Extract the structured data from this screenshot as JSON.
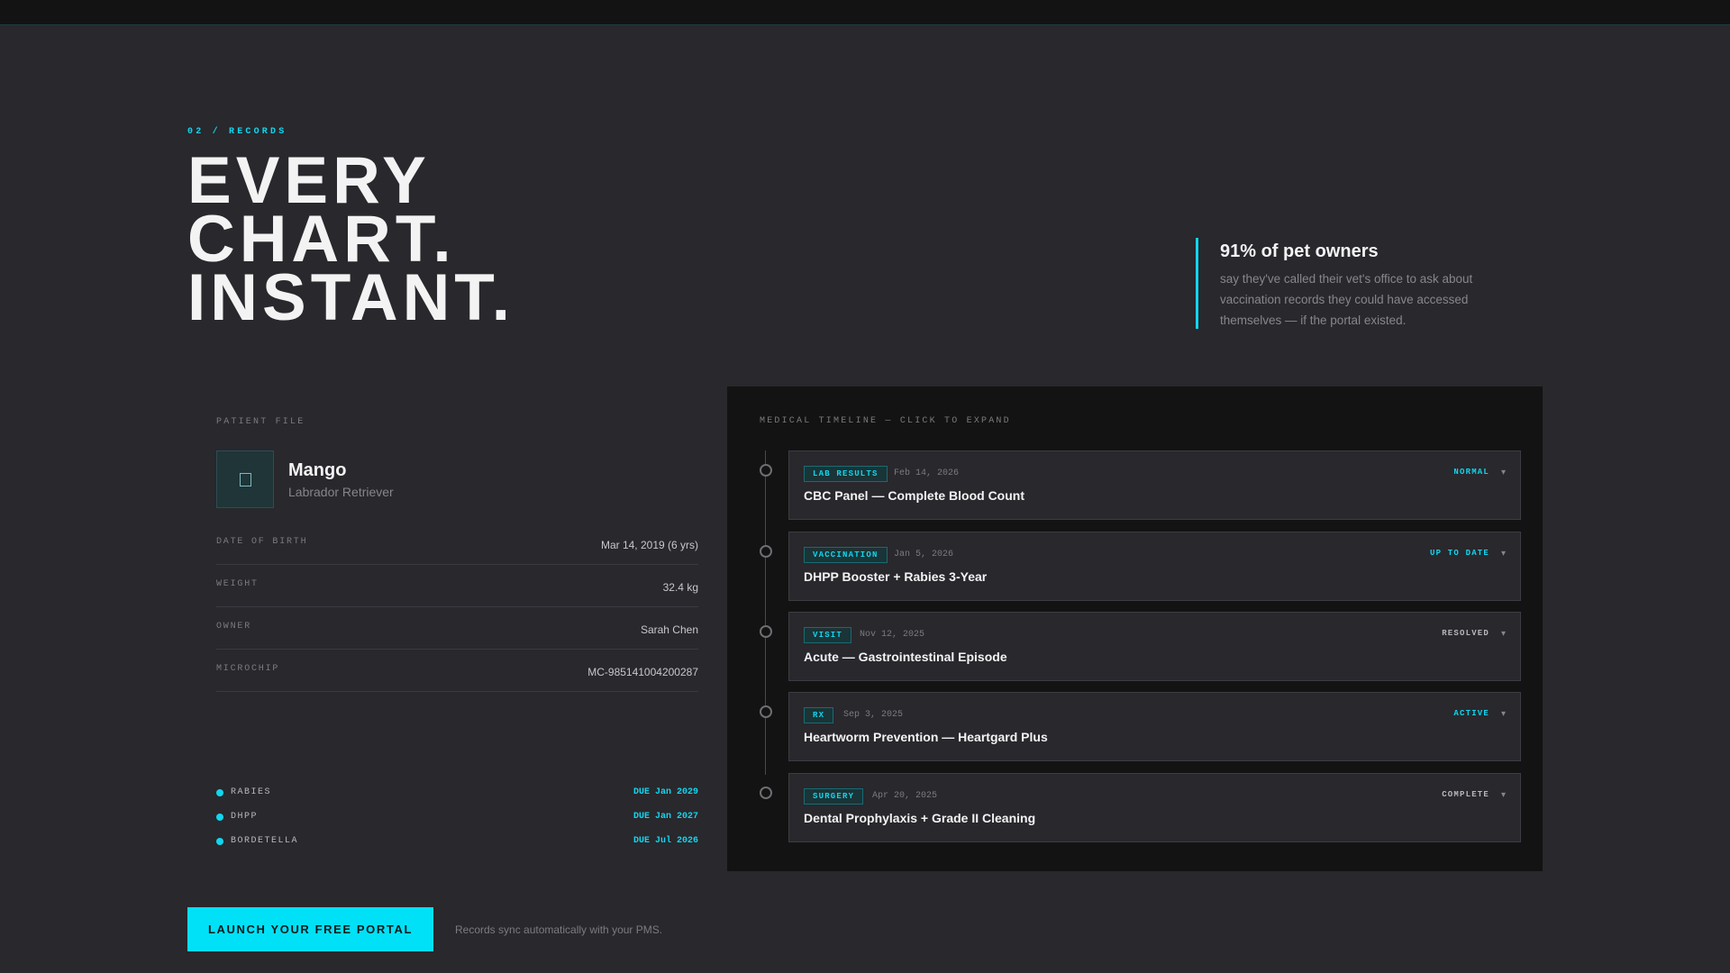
{
  "hero": {
    "eyebrow": "02 / RECORDS",
    "headline": [
      "EVERY",
      "CHART.",
      "INSTANT."
    ]
  },
  "stat": {
    "title": "91% of pet owners",
    "description": "say they've called their vet's office to ask about vaccination records they could have accessed themselves — if the portal existed."
  },
  "patient": {
    "section_label": "PATIENT FILE",
    "avatar_icon": "paw-icon",
    "name": "Mango",
    "breed": "Labrador Retriever",
    "fields": [
      {
        "key": "DATE OF BIRTH",
        "value": "Mar 14, 2019 (6 yrs)"
      },
      {
        "key": "WEIGHT",
        "value": "32.4 kg"
      },
      {
        "key": "OWNER",
        "value": "Sarah Chen"
      },
      {
        "key": "MICROCHIP",
        "value": "MC-985141004200287"
      }
    ],
    "vaccines": [
      {
        "name": "RABIES",
        "due": "DUE Jan 2029"
      },
      {
        "name": "DHPP",
        "due": "DUE Jan 2027"
      },
      {
        "name": "BORDETELLA",
        "due": "DUE Jul 2026"
      }
    ]
  },
  "timeline": {
    "label": "MEDICAL TIMELINE — CLICK TO EXPAND",
    "items": [
      {
        "tag": "LAB RESULTS",
        "date": "Feb 14, 2026",
        "title": "CBC Panel — Complete Blood Count",
        "status": "NORMAL",
        "status_color": "#12d6ee"
      },
      {
        "tag": "VACCINATION",
        "date": "Jan 5, 2026",
        "title": "DHPP Booster + Rabies 3-Year",
        "status": "UP TO DATE",
        "status_color": "#12d6ee"
      },
      {
        "tag": "VISIT",
        "date": "Nov 12, 2025",
        "title": "Acute — Gastrointestinal Episode",
        "status": "RESOLVED",
        "status_color": "#b8b8bd"
      },
      {
        "tag": "RX",
        "date": "Sep 3, 2025",
        "title": "Heartworm Prevention — Heartgard Plus",
        "status": "ACTIVE",
        "status_color": "#12d6ee"
      },
      {
        "tag": "SURGERY",
        "date": "Apr 20, 2025",
        "title": "Dental Prophylaxis + Grade II Cleaning",
        "status": "COMPLETE",
        "status_color": "#b8b8bd"
      }
    ],
    "chevron": "▾"
  },
  "cta": {
    "button_label": "LAUNCH YOUR FREE PORTAL",
    "note": "Records sync automatically with your PMS."
  }
}
